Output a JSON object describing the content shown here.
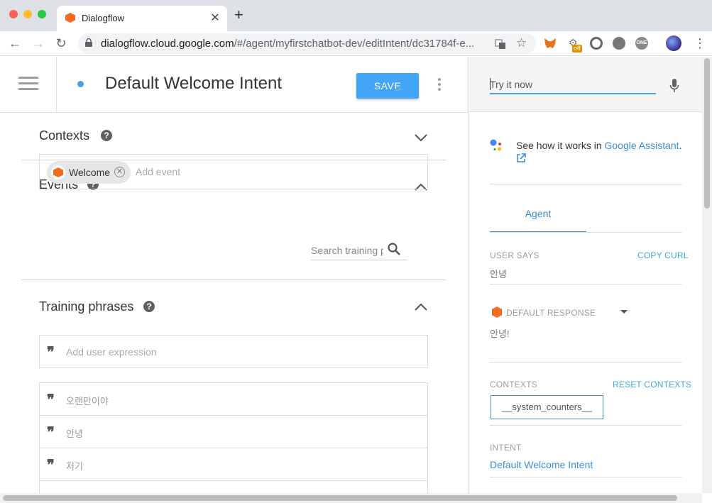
{
  "browser": {
    "tab_title": "Dialogflow",
    "url_host": "dialogflow.cloud.google.com",
    "url_path": "/#/agent/myfirstchatbot-dev/editIntent/dc31784f-e...",
    "ext_off_badge": "off",
    "ext_one_label": "ONE"
  },
  "header": {
    "title": "Default Welcome Intent",
    "save_label": "SAVE"
  },
  "sections": {
    "contexts": "Contexts",
    "events": "Events",
    "training": "Training phrases"
  },
  "events": {
    "chip_label": "Welcome",
    "placeholder": "Add event"
  },
  "training": {
    "search_placeholder": "Search training phrases",
    "add_placeholder": "Add user expression",
    "phrases": [
      "오랜만이야",
      "안녕",
      "저기"
    ]
  },
  "right_panel": {
    "try_placeholder": "Try it now",
    "ga_text": "See how it works in ",
    "ga_link": "Google Assistant",
    "ga_period": ".",
    "tab_agent": "Agent",
    "user_says_label": "USER SAYS",
    "copy_curl": "COPY CURL",
    "user_says_value": "안녕",
    "default_response_label": "DEFAULT RESPONSE",
    "default_response_value": "안녕!",
    "contexts_label": "CONTEXTS",
    "reset_contexts": "RESET CONTEXTS",
    "context_chip": "__system_counters__",
    "intent_label": "INTENT",
    "intent_value": "Default Welcome Intent"
  },
  "colors": {
    "accent": "#42a5f5",
    "link": "#3f8fcf",
    "brand_orange": "#f26b21"
  }
}
